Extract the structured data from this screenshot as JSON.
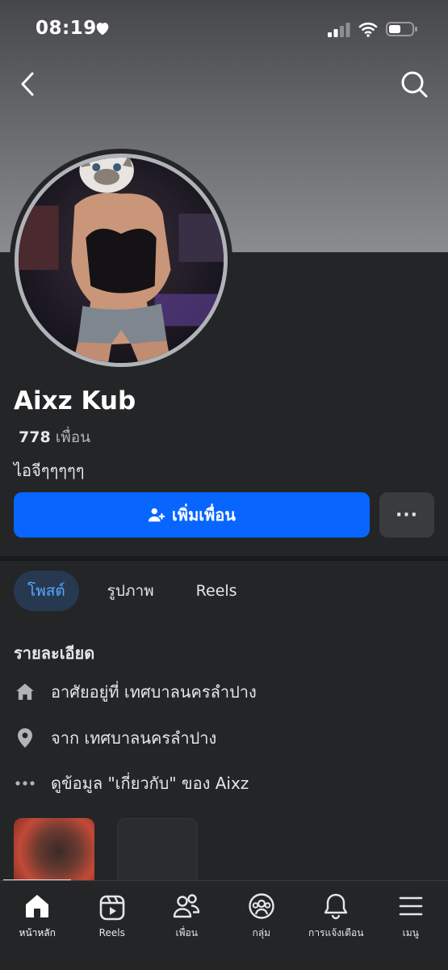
{
  "status_bar": {
    "time": "08:19"
  },
  "profile": {
    "name": "Aixz Kub",
    "friends_count": "778",
    "friends_label": "เพื่อน",
    "bio": "ไอจีๆๆๆๆๆ"
  },
  "actions": {
    "add_friend_label": "เพิ่มเพื่อน",
    "more_label": "···"
  },
  "tabs": [
    {
      "label": "โพสต์",
      "active": true
    },
    {
      "label": "รูปภาพ",
      "active": false
    },
    {
      "label": "Reels",
      "active": false
    }
  ],
  "details": {
    "title": "รายละเอียด",
    "lives_in": "อาศัยอยู่ที่ เทศบาลนครลำปาง",
    "from": "จาก เทศบาลนครลำปาง",
    "about": "ดูข้อมูล \"เกี่ยวกับ\" ของ Aixz"
  },
  "bottom_nav": [
    {
      "label": "หน้าหลัก",
      "icon": "home-icon",
      "active": true
    },
    {
      "label": "Reels",
      "icon": "reels-icon",
      "active": false
    },
    {
      "label": "เพื่อน",
      "icon": "friends-icon",
      "active": false
    },
    {
      "label": "กลุ่ม",
      "icon": "groups-icon",
      "active": false
    },
    {
      "label": "การแจ้งเตือน",
      "icon": "bell-icon",
      "active": false
    },
    {
      "label": "เมนู",
      "icon": "menu-icon",
      "active": false
    }
  ],
  "colors": {
    "accent": "#0866ff",
    "background": "#242526",
    "tab_active_bg": "#263951",
    "tab_active_text": "#5aa7ff"
  }
}
